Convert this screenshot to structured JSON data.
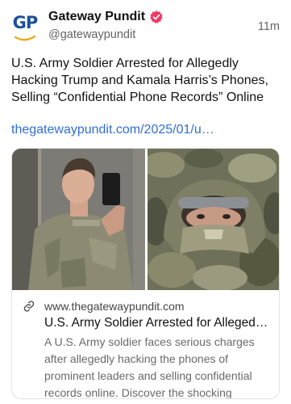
{
  "post": {
    "author": {
      "display_name": "Gateway Pundit",
      "handle": "@gatewaypundit",
      "avatar_text": "GP",
      "verified": true,
      "verified_color": "#ee3a63",
      "avatar_color": "#1d4f9b",
      "avatar_accent": "#f2a81d"
    },
    "timestamp": "11m",
    "text": "U.S. Army Soldier Arrested for Allegedly Hacking Trump and Kamala Harris’s Phones, Selling “Confidential Phone Records” Online",
    "link_text": "thegatewaypundit.com/2025/01/u…",
    "link_color": "#2f6fd8"
  },
  "link_card": {
    "domain": "www.thegatewaypundit.com",
    "title": "U.S. Army Soldier Arrested for Alleged…",
    "description": "A U.S. Army soldier faces serious charges after allegedly hacking the phones of prominent leaders and selling confidential records online. Discover the shocking detail…",
    "icons": [
      "link-icon"
    ]
  }
}
